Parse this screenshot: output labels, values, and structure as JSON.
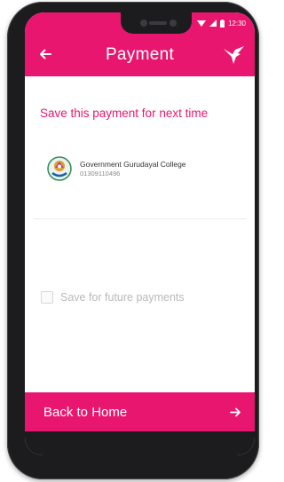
{
  "status_bar": {
    "time": "12:30"
  },
  "app_bar": {
    "title": "Payment"
  },
  "content": {
    "save_heading": "Save this payment for next time",
    "payee": {
      "name": "Government Gurudayal College",
      "account": "01309110496"
    },
    "future_checkbox": {
      "label": "Save for future payments",
      "checked": false
    }
  },
  "bottom_button": {
    "label": "Back to Home"
  },
  "colors": {
    "accent": "#e8166e",
    "muted_text": "#b9b9b9",
    "frame": "#1c1c1e"
  },
  "icons": [
    "back-arrow-icon",
    "bird-icon",
    "wifi-icon",
    "signal-icon",
    "battery-icon",
    "college-logo-icon",
    "forward-arrow-icon"
  ]
}
